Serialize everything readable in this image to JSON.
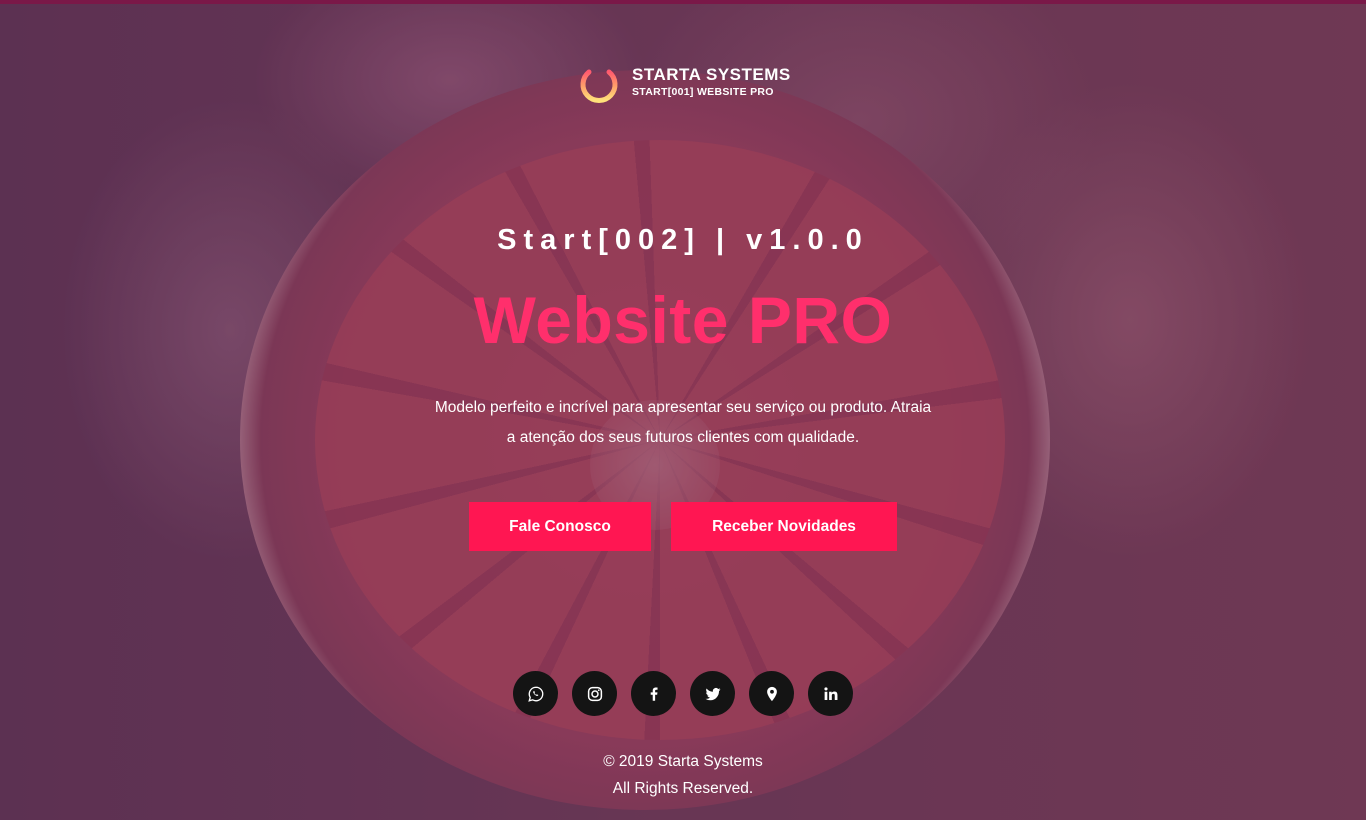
{
  "brand": {
    "name": "STARTA SYSTEMS",
    "subtitle": "START[001] WEBSITE PRO",
    "icon": "power-icon"
  },
  "hero": {
    "version_line": "Start[002] | v1.0.0",
    "headline": "Website PRO",
    "description_line1": "Modelo perfeito e incrível para apresentar seu serviço ou produto. Atraia",
    "description_line2": "a atenção dos seus futuros clientes com qualidade.",
    "buttons": {
      "contact": "Fale Conosco",
      "newsletter": "Receber Novidades"
    }
  },
  "socials": [
    {
      "icon": "whatsapp-icon"
    },
    {
      "icon": "instagram-icon"
    },
    {
      "icon": "facebook-icon"
    },
    {
      "icon": "twitter-icon"
    },
    {
      "icon": "location-pin-icon"
    },
    {
      "icon": "linkedin-icon"
    }
  ],
  "footer": {
    "copyright": "© 2019 Starta Systems",
    "rights": "All Rights Reserved."
  },
  "colors": {
    "accent": "#ff1652",
    "headline": "#ff2f6c",
    "social_bg": "#141414",
    "text": "#ffffff"
  }
}
